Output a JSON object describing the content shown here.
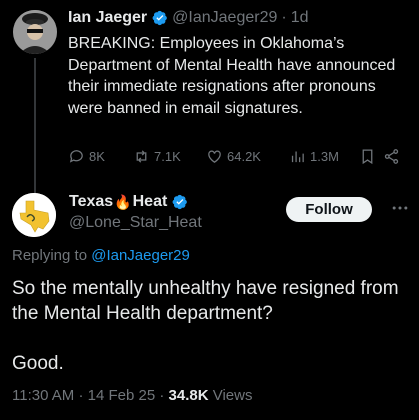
{
  "tweet1": {
    "name": "Ian Jaeger",
    "handle": "@IanJaeger29",
    "separator": "·",
    "time": "1d",
    "text": "BREAKING: Employees in Oklahoma’s Department of Mental Health have announced their immediate resignations after pronouns were banned in email signatures.",
    "replies": "8K",
    "reposts": "7.1K",
    "likes": "64.2K",
    "views": "1.3M"
  },
  "tweet2": {
    "name": "Texas",
    "name_emoji": "🔥",
    "name_suffix": "Heat",
    "handle": "@Lone_Star_Heat",
    "follow_label": "Follow",
    "replying_prefix": "Replying to",
    "replying_handle": "@IanJaeger29",
    "text_line1": "So the mentally unhealthy have resigned from the Mental Health department?",
    "text_line2": "Good.",
    "time": "11:30 AM",
    "date": "14 Feb 25",
    "views_count": "34.8K",
    "views_label": "Views",
    "dot": "·"
  },
  "colors": {
    "background": "#000000",
    "text": "#e7e9ea",
    "muted": "#71767b",
    "accent": "#1d9bf0"
  },
  "icons": [
    "verified-badge-icon",
    "reply-icon",
    "repost-icon",
    "like-icon",
    "views-icon",
    "bookmark-icon",
    "share-icon",
    "more-icon",
    "texas-flag-avatar-icon"
  ]
}
